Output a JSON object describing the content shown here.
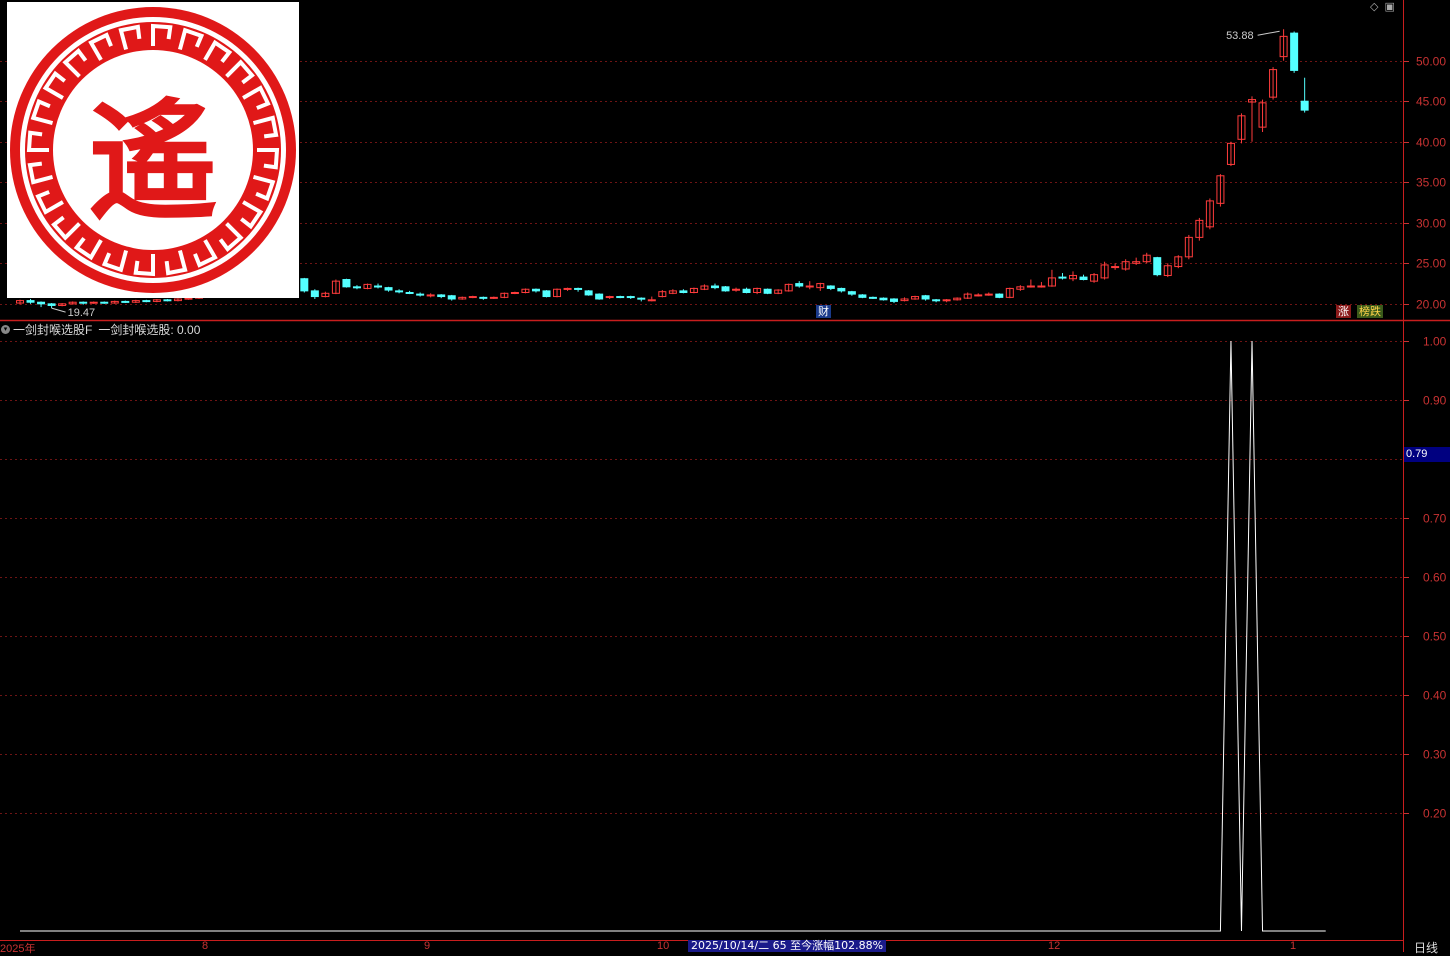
{
  "chart_data": [
    {
      "type": "candlestick",
      "title": "",
      "y_ticks": [
        "50.00",
        "45.00",
        "40.00",
        "35.00",
        "30.00",
        "25.00",
        "20.00"
      ],
      "ylim": [
        18.5,
        56.5
      ],
      "annotations": {
        "high": "53.88",
        "low": "19.47"
      },
      "candles": [
        {
          "o": 20.1,
          "c": 20.4,
          "h": 20.5,
          "l": 19.9
        },
        {
          "o": 20.4,
          "c": 20.2,
          "h": 20.6,
          "l": 20.0
        },
        {
          "o": 20.2,
          "c": 20.0,
          "h": 20.3,
          "l": 19.6
        },
        {
          "o": 20.0,
          "c": 19.8,
          "h": 20.1,
          "l": 19.47
        },
        {
          "o": 19.8,
          "c": 20.0,
          "h": 20.1,
          "l": 19.7
        },
        {
          "o": 20.0,
          "c": 20.2,
          "h": 20.3,
          "l": 19.9
        },
        {
          "o": 20.2,
          "c": 20.1,
          "h": 20.3,
          "l": 19.9
        },
        {
          "o": 20.1,
          "c": 20.2,
          "h": 20.3,
          "l": 20.0
        },
        {
          "o": 20.2,
          "c": 20.1,
          "h": 20.3,
          "l": 20.0
        },
        {
          "o": 20.1,
          "c": 20.3,
          "h": 20.4,
          "l": 20.0
        },
        {
          "o": 20.3,
          "c": 20.2,
          "h": 20.4,
          "l": 20.1
        },
        {
          "o": 20.2,
          "c": 20.4,
          "h": 20.5,
          "l": 20.1
        },
        {
          "o": 20.4,
          "c": 20.3,
          "h": 20.5,
          "l": 20.2
        },
        {
          "o": 20.3,
          "c": 20.5,
          "h": 20.6,
          "l": 20.2
        },
        {
          "o": 20.5,
          "c": 20.4,
          "h": 20.6,
          "l": 20.3
        },
        {
          "o": 20.4,
          "c": 20.6,
          "h": 20.7,
          "l": 20.3
        },
        {
          "o": 20.6,
          "c": 20.7,
          "h": 20.8,
          "l": 20.5
        },
        {
          "o": 20.7,
          "c": 20.9,
          "h": 21.0,
          "l": 20.6
        },
        {
          "o": 20.9,
          "c": 21.3,
          "h": 21.5,
          "l": 20.8
        },
        {
          "o": 21.3,
          "c": 21.9,
          "h": 22.2,
          "l": 21.1
        },
        {
          "o": 21.9,
          "c": 23.3,
          "h": 23.6,
          "l": 21.8
        },
        {
          "o": 23.4,
          "c": 23.3,
          "h": 24.0,
          "l": 22.8
        },
        {
          "o": 23.1,
          "c": 22.5,
          "h": 23.3,
          "l": 22.3
        },
        {
          "o": 22.9,
          "c": 23.4,
          "h": 23.8,
          "l": 22.7
        },
        {
          "o": 23.5,
          "c": 25.2,
          "h": 25.4,
          "l": 23.4
        },
        {
          "o": 25.0,
          "c": 24.2,
          "h": 25.3,
          "l": 24.0
        },
        {
          "o": 24.1,
          "c": 23.2,
          "h": 24.3,
          "l": 23.0
        },
        {
          "o": 23.1,
          "c": 21.6,
          "h": 23.2,
          "l": 21.4
        },
        {
          "o": 21.6,
          "c": 20.9,
          "h": 21.8,
          "l": 20.6
        },
        {
          "o": 20.9,
          "c": 21.3,
          "h": 21.5,
          "l": 20.8
        },
        {
          "o": 21.3,
          "c": 22.8,
          "h": 23.0,
          "l": 21.2
        },
        {
          "o": 23.0,
          "c": 22.1,
          "h": 23.1,
          "l": 22.0
        },
        {
          "o": 22.1,
          "c": 22.0,
          "h": 22.3,
          "l": 21.8
        },
        {
          "o": 21.9,
          "c": 22.4,
          "h": 22.5,
          "l": 21.8
        },
        {
          "o": 22.2,
          "c": 22.1,
          "h": 22.5,
          "l": 21.9
        },
        {
          "o": 22.0,
          "c": 21.7,
          "h": 22.1,
          "l": 21.5
        },
        {
          "o": 21.6,
          "c": 21.5,
          "h": 21.8,
          "l": 21.3
        },
        {
          "o": 21.4,
          "c": 21.3,
          "h": 21.6,
          "l": 21.2
        },
        {
          "o": 21.2,
          "c": 21.1,
          "h": 21.4,
          "l": 20.9
        },
        {
          "o": 21.0,
          "c": 21.1,
          "h": 21.3,
          "l": 20.8
        },
        {
          "o": 21.1,
          "c": 20.9,
          "h": 21.2,
          "l": 20.7
        },
        {
          "o": 21.0,
          "c": 20.6,
          "h": 21.1,
          "l": 20.4
        },
        {
          "o": 20.6,
          "c": 20.8,
          "h": 20.9,
          "l": 20.5
        },
        {
          "o": 20.8,
          "c": 20.9,
          "h": 21.0,
          "l": 20.7
        },
        {
          "o": 20.8,
          "c": 20.7,
          "h": 20.9,
          "l": 20.5
        },
        {
          "o": 20.7,
          "c": 20.8,
          "h": 20.9,
          "l": 20.6
        },
        {
          "o": 20.8,
          "c": 21.3,
          "h": 21.4,
          "l": 20.7
        },
        {
          "o": 21.3,
          "c": 21.4,
          "h": 21.5,
          "l": 21.2
        },
        {
          "o": 21.4,
          "c": 21.8,
          "h": 21.9,
          "l": 21.3
        },
        {
          "o": 21.8,
          "c": 21.6,
          "h": 21.9,
          "l": 21.4
        },
        {
          "o": 21.6,
          "c": 20.9,
          "h": 21.7,
          "l": 20.8
        },
        {
          "o": 20.9,
          "c": 21.8,
          "h": 21.9,
          "l": 20.8
        },
        {
          "o": 21.8,
          "c": 21.9,
          "h": 22.0,
          "l": 21.6
        },
        {
          "o": 21.9,
          "c": 21.8,
          "h": 22.0,
          "l": 21.5
        },
        {
          "o": 21.6,
          "c": 21.1,
          "h": 21.7,
          "l": 21.0
        },
        {
          "o": 21.2,
          "c": 20.6,
          "h": 21.3,
          "l": 20.5
        },
        {
          "o": 20.8,
          "c": 20.9,
          "h": 21.0,
          "l": 20.6
        },
        {
          "o": 20.9,
          "c": 20.8,
          "h": 21.0,
          "l": 20.7
        },
        {
          "o": 20.9,
          "c": 20.8,
          "h": 21.0,
          "l": 20.6
        },
        {
          "o": 20.7,
          "c": 20.6,
          "h": 20.8,
          "l": 20.3
        },
        {
          "o": 20.4,
          "c": 20.5,
          "h": 20.9,
          "l": 20.3
        },
        {
          "o": 20.9,
          "c": 21.5,
          "h": 21.7,
          "l": 20.8
        },
        {
          "o": 21.3,
          "c": 21.6,
          "h": 21.8,
          "l": 21.2
        },
        {
          "o": 21.6,
          "c": 21.4,
          "h": 21.8,
          "l": 21.3
        },
        {
          "o": 21.4,
          "c": 21.9,
          "h": 22.0,
          "l": 21.3
        },
        {
          "o": 21.8,
          "c": 22.2,
          "h": 22.4,
          "l": 21.7
        },
        {
          "o": 22.2,
          "c": 22.0,
          "h": 22.5,
          "l": 21.8
        },
        {
          "o": 22.1,
          "c": 21.6,
          "h": 22.2,
          "l": 21.5
        },
        {
          "o": 21.7,
          "c": 21.8,
          "h": 22.0,
          "l": 21.5
        },
        {
          "o": 21.8,
          "c": 21.4,
          "h": 22.0,
          "l": 21.3
        },
        {
          "o": 21.4,
          "c": 21.9,
          "h": 22.0,
          "l": 21.2
        },
        {
          "o": 21.8,
          "c": 21.3,
          "h": 21.9,
          "l": 21.2
        },
        {
          "o": 21.3,
          "c": 21.7,
          "h": 21.8,
          "l": 21.2
        },
        {
          "o": 21.6,
          "c": 22.4,
          "h": 22.5,
          "l": 21.5
        },
        {
          "o": 22.5,
          "c": 22.2,
          "h": 22.8,
          "l": 22.0
        },
        {
          "o": 22.2,
          "c": 22.2,
          "h": 22.8,
          "l": 21.8
        },
        {
          "o": 22.0,
          "c": 22.5,
          "h": 22.6,
          "l": 21.6
        },
        {
          "o": 22.2,
          "c": 21.9,
          "h": 22.3,
          "l": 21.7
        },
        {
          "o": 21.9,
          "c": 21.6,
          "h": 22.0,
          "l": 21.4
        },
        {
          "o": 21.5,
          "c": 21.2,
          "h": 21.6,
          "l": 21.0
        },
        {
          "o": 21.1,
          "c": 20.8,
          "h": 21.2,
          "l": 20.7
        },
        {
          "o": 20.8,
          "c": 20.7,
          "h": 20.9,
          "l": 20.6
        },
        {
          "o": 20.7,
          "c": 20.5,
          "h": 20.8,
          "l": 20.4
        },
        {
          "o": 20.6,
          "c": 20.3,
          "h": 20.7,
          "l": 20.1
        },
        {
          "o": 20.4,
          "c": 20.6,
          "h": 20.8,
          "l": 20.3
        },
        {
          "o": 20.6,
          "c": 20.9,
          "h": 21.0,
          "l": 20.5
        },
        {
          "o": 21.0,
          "c": 20.6,
          "h": 21.1,
          "l": 20.4
        },
        {
          "o": 20.5,
          "c": 20.4,
          "h": 20.6,
          "l": 20.2
        },
        {
          "o": 20.4,
          "c": 20.5,
          "h": 20.6,
          "l": 20.2
        },
        {
          "o": 20.5,
          "c": 20.7,
          "h": 20.8,
          "l": 20.4
        },
        {
          "o": 20.7,
          "c": 21.2,
          "h": 21.4,
          "l": 20.6
        },
        {
          "o": 21.0,
          "c": 21.1,
          "h": 21.3,
          "l": 20.9
        },
        {
          "o": 21.1,
          "c": 21.2,
          "h": 21.4,
          "l": 21.0
        },
        {
          "o": 21.2,
          "c": 20.8,
          "h": 21.3,
          "l": 20.7
        },
        {
          "o": 20.8,
          "c": 21.9,
          "h": 22.0,
          "l": 20.7
        },
        {
          "o": 21.8,
          "c": 22.1,
          "h": 22.3,
          "l": 21.6
        },
        {
          "o": 22.1,
          "c": 22.2,
          "h": 23.0,
          "l": 22.0
        },
        {
          "o": 22.2,
          "c": 22.2,
          "h": 22.7,
          "l": 22.0
        },
        {
          "o": 22.2,
          "c": 23.2,
          "h": 24.2,
          "l": 22.1
        },
        {
          "o": 23.3,
          "c": 23.2,
          "h": 23.8,
          "l": 23.0
        },
        {
          "o": 23.1,
          "c": 23.5,
          "h": 24.0,
          "l": 22.8
        },
        {
          "o": 23.3,
          "c": 23.0,
          "h": 23.6,
          "l": 22.9
        },
        {
          "o": 22.8,
          "c": 23.6,
          "h": 23.8,
          "l": 22.6
        },
        {
          "o": 23.2,
          "c": 24.8,
          "h": 25.2,
          "l": 23.0
        },
        {
          "o": 24.5,
          "c": 24.6,
          "h": 25.0,
          "l": 24.2
        },
        {
          "o": 24.3,
          "c": 25.2,
          "h": 25.5,
          "l": 24.1
        },
        {
          "o": 25.0,
          "c": 25.2,
          "h": 25.7,
          "l": 24.8
        },
        {
          "o": 25.2,
          "c": 26.0,
          "h": 26.3,
          "l": 25.0
        },
        {
          "o": 25.7,
          "c": 23.6,
          "h": 25.8,
          "l": 23.4
        },
        {
          "o": 23.5,
          "c": 24.7,
          "h": 25.0,
          "l": 23.3
        },
        {
          "o": 24.6,
          "c": 25.8,
          "h": 26.0,
          "l": 24.4
        },
        {
          "o": 25.8,
          "c": 28.2,
          "h": 28.5,
          "l": 25.5
        },
        {
          "o": 28.2,
          "c": 30.3,
          "h": 30.6,
          "l": 27.8
        },
        {
          "o": 29.5,
          "c": 32.7,
          "h": 33.0,
          "l": 29.2
        },
        {
          "o": 32.4,
          "c": 35.8,
          "h": 36.0,
          "l": 32.0
        },
        {
          "o": 37.2,
          "c": 39.8,
          "h": 40.0,
          "l": 37.0
        },
        {
          "o": 40.3,
          "c": 43.2,
          "h": 43.5,
          "l": 39.8
        },
        {
          "o": 44.9,
          "c": 45.2,
          "h": 45.6,
          "l": 40.0
        },
        {
          "o": 41.8,
          "c": 44.8,
          "h": 45.2,
          "l": 41.2
        },
        {
          "o": 45.5,
          "c": 48.9,
          "h": 49.2,
          "l": 45.2
        },
        {
          "o": 50.5,
          "c": 53.0,
          "h": 53.88,
          "l": 50.0
        },
        {
          "o": 53.4,
          "c": 48.8,
          "h": 53.6,
          "l": 48.5
        },
        {
          "o": 45.0,
          "c": 43.9,
          "h": 47.9,
          "l": 43.6
        }
      ]
    },
    {
      "type": "line",
      "series_name": "一剑封喉选股",
      "y_ticks": [
        "1.00",
        "0.90",
        "0.70",
        "0.60",
        "0.50",
        "0.40",
        "0.30",
        "0.20"
      ],
      "ylim": [
        0,
        1
      ],
      "values": [
        0,
        0,
        0,
        0,
        0,
        0,
        0,
        0,
        0,
        0,
        0,
        0,
        0,
        0,
        0,
        0,
        0,
        0,
        0,
        0,
        0,
        0,
        0,
        0,
        0,
        0,
        0,
        0,
        0,
        0,
        0,
        0,
        0,
        0,
        0,
        0,
        0,
        0,
        0,
        0,
        0,
        0,
        0,
        0,
        0,
        0,
        0,
        0,
        0,
        0,
        0,
        0,
        0,
        0,
        0,
        0,
        0,
        0,
        0,
        0,
        0,
        0,
        0,
        0,
        0,
        0,
        0,
        0,
        0,
        0,
        0,
        0,
        0,
        0,
        0,
        0,
        0,
        0,
        0,
        0,
        0,
        0,
        0,
        0,
        0,
        0,
        0,
        0,
        0,
        0,
        0,
        0,
        0,
        0,
        0,
        0,
        0,
        0,
        0,
        0,
        0,
        0,
        0,
        0,
        0,
        0,
        0,
        0,
        0,
        0,
        0,
        0,
        0,
        0,
        0,
        1,
        0,
        1,
        0,
        0,
        0,
        0,
        0,
        0,
        0
      ]
    }
  ],
  "indicator_header": {
    "name": "一剑封喉选股F",
    "value_label": "一剑封喉选股: 0.00"
  },
  "current_value_tag": "0.79",
  "tags": {
    "cai": "财",
    "zhang": "涨",
    "bang": "榜跌"
  },
  "date_axis": {
    "year": "2025年",
    "m8": "8",
    "m9": "9",
    "m10": "10",
    "m12": "12",
    "m1": "1"
  },
  "date_highlight": "2025/10/14/二 65 至今涨幅102.88%",
  "period": "日线",
  "colors": {
    "up": "#ff3c3c",
    "down": "#54ffff",
    "grid": "#6e1414",
    "axis": "#c83232",
    "line": "#ffffff"
  }
}
